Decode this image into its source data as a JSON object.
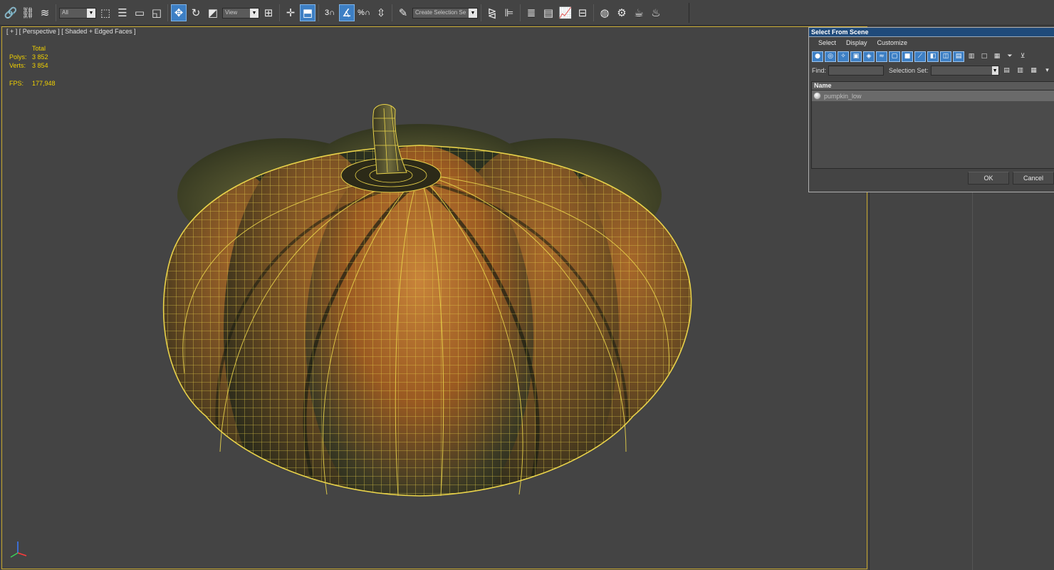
{
  "toolbar": {
    "filter_select": "All",
    "ref_coord_select": "View",
    "snap_label": "3",
    "percent_snap_label": "%",
    "selection_set_select": "Create Selection Se"
  },
  "viewport": {
    "label": "[ + ] [ Perspective ] [ Shaded + Edged Faces ]",
    "stats": {
      "total_label": "Total",
      "polys_label": "Polys:",
      "polys_value": "3 852",
      "verts_label": "Verts:",
      "verts_value": "3 854",
      "fps_label": "FPS:",
      "fps_value": "177,948"
    }
  },
  "dialog": {
    "title": "Select From Scene",
    "menu": [
      "Select",
      "Display",
      "Customize"
    ],
    "find_label": "Find:",
    "selection_set_label": "Selection Set:",
    "list_header": "Name",
    "items": [
      "pumpkin_low"
    ],
    "ok_label": "OK",
    "cancel_label": "Cancel"
  },
  "colors": {
    "accent_blue": "#3d7fc4",
    "stats_yellow": "#f0d000",
    "viewport_border": "#c8a82e",
    "wire_yellow": "#e8d24a",
    "pumpkin_orange": "#b8742e",
    "pumpkin_dark": "#2d3322"
  }
}
